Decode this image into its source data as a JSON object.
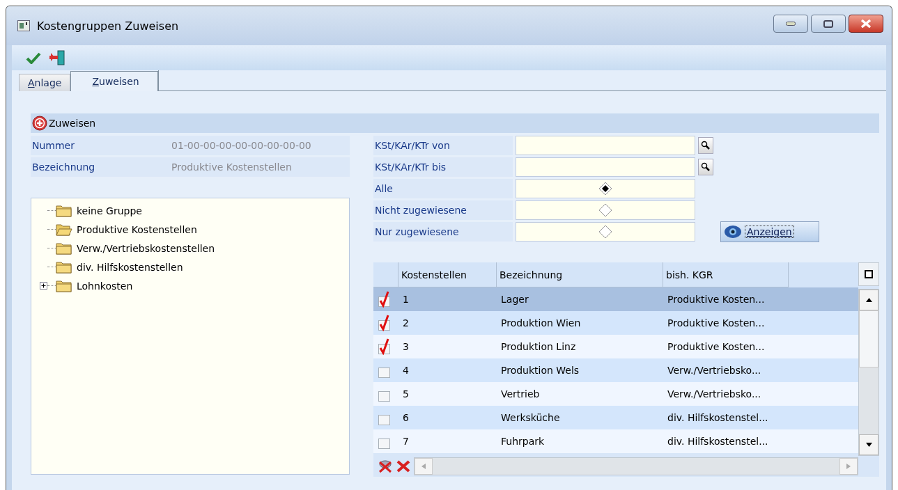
{
  "window": {
    "title": "Kostengruppen Zuweisen"
  },
  "tabs": [
    {
      "label": "Anlage",
      "selected": false
    },
    {
      "label": "Zuweisen",
      "selected": true
    }
  ],
  "section": {
    "title": "Zuweisen"
  },
  "fields": [
    {
      "label": "Nummer",
      "value": "01-00-00-00-00-00-00-00-00"
    },
    {
      "label": "Bezeichnung",
      "value": "Produktive Kostenstellen"
    }
  ],
  "tree": [
    {
      "kind": "leaf",
      "label": "keine Gruppe",
      "open": false
    },
    {
      "kind": "leaf",
      "label": "Produktive Kostenstellen",
      "open": true
    },
    {
      "kind": "leaf",
      "label": "Verw./Vertriebskostenstellen",
      "open": false
    },
    {
      "kind": "leaf",
      "label": "div. Hilfskostenstellen",
      "open": false
    },
    {
      "kind": "collapsed",
      "label": "Lohnkosten",
      "open": false
    }
  ],
  "filters": [
    {
      "kind": "search",
      "label": "KSt/KAr/KTr von"
    },
    {
      "kind": "search",
      "label": "KSt/KAr/KTr bis"
    },
    {
      "kind": "radio",
      "label": "Alle",
      "selected": true
    },
    {
      "kind": "radio",
      "label": "Nicht zugewiesene",
      "selected": false
    },
    {
      "kind": "radio",
      "label": "Nur zugewiesene",
      "selected": false
    }
  ],
  "show_button": "Anzeigen",
  "table": {
    "columns": [
      "Kostenstellen",
      "Bezeichnung",
      "bish. KGR"
    ],
    "rows": [
      {
        "checked": true,
        "selected": true,
        "cells": [
          "1",
          "Lager",
          "Produktive Kosten..."
        ]
      },
      {
        "checked": true,
        "selected": false,
        "cells": [
          "2",
          "Produktion Wien",
          "Produktive Kosten..."
        ]
      },
      {
        "checked": true,
        "selected": false,
        "cells": [
          "3",
          "Produktion Linz",
          "Produktive Kosten..."
        ]
      },
      {
        "checked": false,
        "selected": false,
        "cells": [
          "4",
          "Produktion Wels",
          "Verw./Vertriebsko..."
        ]
      },
      {
        "checked": false,
        "selected": false,
        "cells": [
          "5",
          "Vertrieb",
          "Verw./Vertriebsko..."
        ]
      },
      {
        "checked": false,
        "selected": false,
        "cells": [
          "6",
          "Werksküche",
          "div. Hilfskostenstel..."
        ]
      },
      {
        "checked": false,
        "selected": false,
        "cells": [
          "7",
          "Fuhrpark",
          "div. Hilfskostenstel..."
        ]
      }
    ]
  }
}
